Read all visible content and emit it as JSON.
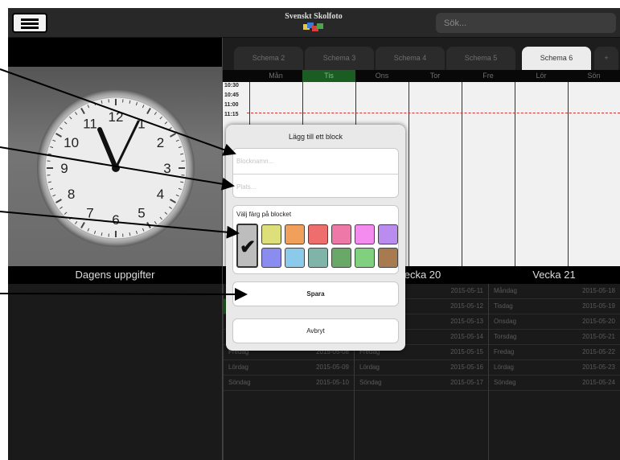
{
  "header": {
    "logo_text": "Svenskt Skolfoto",
    "search_placeholder": "Sök..."
  },
  "left_panel": {
    "clock_numbers": [
      "12",
      "1",
      "2",
      "3",
      "4",
      "5",
      "6",
      "7",
      "8",
      "9",
      "10",
      "11"
    ],
    "section_title": "Dagens uppgifter"
  },
  "tabs": [
    {
      "label": "Schema 2",
      "active": false
    },
    {
      "label": "Schema 3",
      "active": false
    },
    {
      "label": "Schema 4",
      "active": false
    },
    {
      "label": "Schema 5",
      "active": false
    },
    {
      "label": "Schema 6",
      "active": true
    },
    {
      "label": "+",
      "active": false
    }
  ],
  "days": [
    {
      "label": "Mån",
      "today": false
    },
    {
      "label": "Tis",
      "today": true
    },
    {
      "label": "Ons",
      "today": false
    },
    {
      "label": "Tor",
      "today": false
    },
    {
      "label": "Fre",
      "today": false
    },
    {
      "label": "Lör",
      "today": false
    },
    {
      "label": "Sön",
      "today": false
    }
  ],
  "times": [
    "10:30",
    "10:45",
    "11:00",
    "11:15"
  ],
  "weeks": {
    "week20_title": "ecka 20",
    "week21_title": "Vecka 21",
    "col1": [
      {
        "day": "",
        "date": "",
        "green": false
      },
      {
        "day": "",
        "date": "",
        "green": true
      },
      {
        "day": "",
        "date": "",
        "green": false
      },
      {
        "day": "",
        "date": "",
        "green": false
      },
      {
        "day": "Fredag",
        "date": "2015-05-08",
        "green": false
      },
      {
        "day": "Lördag",
        "date": "2015-05-09",
        "green": false
      },
      {
        "day": "Söndag",
        "date": "2015-05-10",
        "green": false
      }
    ],
    "col2": [
      {
        "day": "",
        "date": "2015-05-11",
        "green": false
      },
      {
        "day": "",
        "date": "2015-05-12",
        "green": false
      },
      {
        "day": "",
        "date": "2015-05-13",
        "green": false
      },
      {
        "day": "",
        "date": "2015-05-14",
        "green": false
      },
      {
        "day": "Fredag",
        "date": "2015-05-15",
        "green": false
      },
      {
        "day": "Lördag",
        "date": "2015-05-16",
        "green": false
      },
      {
        "day": "Söndag",
        "date": "2015-05-17",
        "green": false
      }
    ],
    "col3": [
      {
        "day": "Måndag",
        "date": "2015-05-18",
        "green": false
      },
      {
        "day": "Tisdag",
        "date": "2015-05-19",
        "green": false
      },
      {
        "day": "Onsdag",
        "date": "2015-05-20",
        "green": false
      },
      {
        "day": "Torsdag",
        "date": "2015-05-21",
        "green": false
      },
      {
        "day": "Fredag",
        "date": "2015-05-22",
        "green": false
      },
      {
        "day": "Lördag",
        "date": "2015-05-23",
        "green": false
      },
      {
        "day": "Söndag",
        "date": "2015-05-24",
        "green": false
      }
    ]
  },
  "modal": {
    "title": "Lägg till ett block",
    "name_placeholder": "Blocknamn...",
    "place_placeholder": "Plats...",
    "color_label": "Välj färg på blocket",
    "colors": [
      "#bdbdbd",
      "#dde07a",
      "#f0a05a",
      "#ee6e6e",
      "#ee78a8",
      "#f48cf0",
      "#bb8cf0",
      "#8a8cf0",
      "#8ccaec",
      "#80b4a8",
      "#6aa868",
      "#80d080",
      "#a87a50"
    ],
    "selected_color_index": 0,
    "save_label": "Spara",
    "cancel_label": "Avbryt"
  }
}
